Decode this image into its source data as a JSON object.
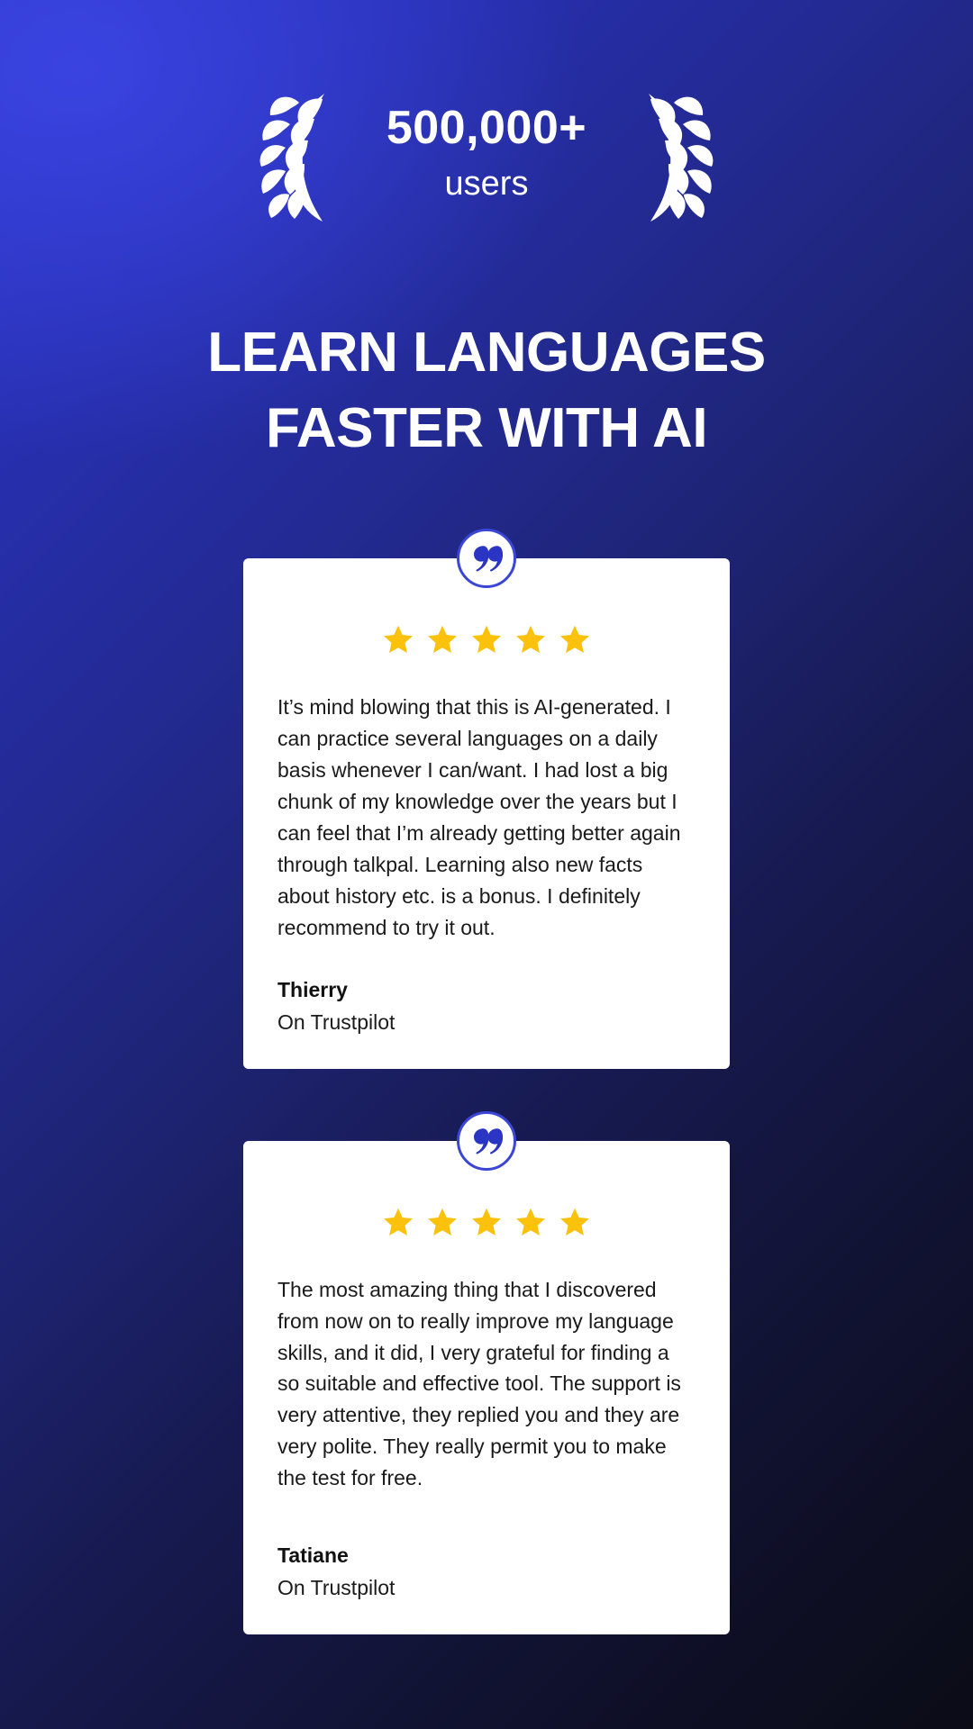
{
  "hero": {
    "badge": {
      "count": "500,000+",
      "label": "users",
      "laurel_left_icon": "laurel-wreath-left-icon",
      "laurel_right_icon": "laurel-wreath-right-icon"
    },
    "headline_line1": "LEARN LANGUAGES",
    "headline_line2": "FASTER WITH AI"
  },
  "colors": {
    "background_start": "#2c36c6",
    "background_end": "#0b0c16",
    "accent_blue": "#3b46d6",
    "star_gold": "#fcc10b",
    "card_background": "#ffffff",
    "text_dark": "#1a1a1a"
  },
  "testimonials": [
    {
      "rating": 5,
      "rating_label": "5 out of 5 stars",
      "quote_icon": "quote-mark-icon",
      "text": "It’s mind blowing that this is AI-generated. I can practice several languages on a daily basis whenever I can/want. I had lost a big chunk of my knowledge over the years but I can feel that I’m already getting better again through talkpal. Learning also new facts about history etc. is a bonus. I definitely recommend to try it out.",
      "author": "Thierry",
      "source": "On Trustpilot"
    },
    {
      "rating": 5,
      "rating_label": "5 out of 5 stars",
      "quote_icon": "quote-mark-icon",
      "text": "The most amazing thing that I discovered from now on to really improve my language skills, and it did, I very grateful for finding a so suitable and effective tool. The support is very attentive, they replied you and they are very polite. They really permit you to make the test for free.",
      "author": "Tatiane",
      "source": "On Trustpilot"
    }
  ]
}
